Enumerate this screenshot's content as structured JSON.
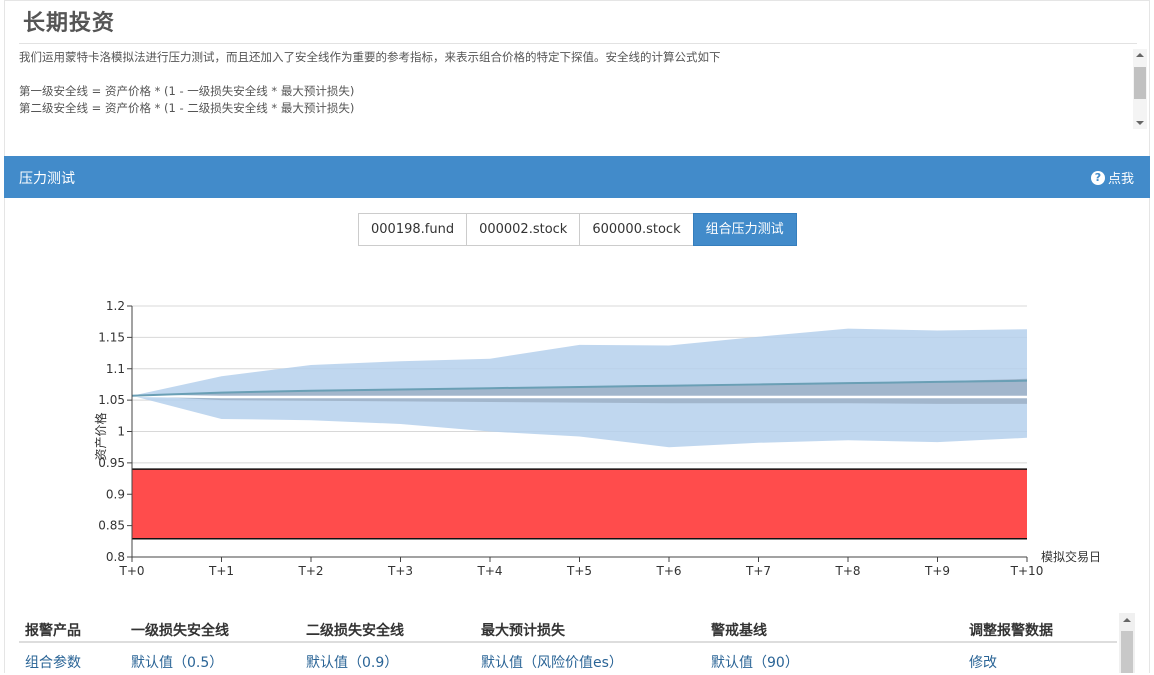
{
  "header": {
    "title": "长期投资",
    "description": [
      "我们运用蒙特卡洛模拟法进行压力测试，而且还加入了安全线作为重要的参考指标，来表示组合价格的特定下探值。安全线的计算公式如下",
      "",
      "第一级安全线 = 资产价格 * (1 - 一级损失安全线 * 最大预计损失)",
      "第二级安全线 = 资产价格 * (1 - 二级损失安全线 * 最大预计损失)"
    ]
  },
  "panel": {
    "title": "压力测试",
    "help_label": "点我",
    "help_icon": "question-circle-icon",
    "accent_color": "#428bca"
  },
  "buttons": [
    {
      "label": "000198.fund",
      "active": false
    },
    {
      "label": "000002.stock",
      "active": false
    },
    {
      "label": "600000.stock",
      "active": false
    },
    {
      "label": "组合压力测试",
      "active": true
    }
  ],
  "chart_data": {
    "type": "area",
    "xlabel": "模拟交易日",
    "ylabel": "资产价格",
    "ylim": [
      0.8,
      1.2
    ],
    "yticks": [
      0.8,
      0.85,
      0.9,
      0.95,
      1,
      1.05,
      1.1,
      1.15,
      1.2
    ],
    "ytick_labels": [
      "0.8",
      "0.85",
      "0.9",
      "0.95",
      "1",
      "1.05",
      "1.1",
      "1.15",
      "1.2"
    ],
    "categories": [
      "T+0",
      "T+1",
      "T+2",
      "T+3",
      "T+4",
      "T+5",
      "T+6",
      "T+7",
      "T+8",
      "T+9",
      "T+10"
    ],
    "grid": true,
    "outer_band": {
      "color": "#b5d0ec",
      "upper": [
        1.057,
        1.088,
        1.106,
        1.112,
        1.116,
        1.138,
        1.137,
        1.151,
        1.164,
        1.161,
        1.163
      ],
      "lower": [
        1.057,
        1.02,
        1.018,
        1.012,
        1.0,
        0.992,
        0.975,
        0.982,
        0.986,
        0.983,
        0.99
      ]
    },
    "inner_band": {
      "color": "#9fb3c8",
      "upper": [
        1.057,
        1.063,
        1.066,
        1.068,
        1.07,
        1.072,
        1.074,
        1.076,
        1.078,
        1.08,
        1.084
      ],
      "lower": [
        1.057,
        1.05,
        1.049,
        1.048,
        1.047,
        1.046,
        1.045,
        1.045,
        1.045,
        1.044,
        1.044
      ]
    },
    "median_line": {
      "color": "#6a9fb5",
      "values": [
        1.057,
        1.062,
        1.065,
        1.067,
        1.069,
        1.071,
        1.073,
        1.075,
        1.077,
        1.079,
        1.081
      ]
    },
    "white_line": {
      "color": "#ffffff",
      "values": [
        1.057,
        1.055,
        1.055,
        1.055,
        1.055,
        1.055,
        1.055,
        1.055,
        1.055,
        1.055,
        1.055
      ]
    },
    "safety_zone": {
      "color": "#ff4c4c",
      "upper": 0.94,
      "lower": 0.829
    }
  },
  "table": {
    "headers": [
      "报警产品",
      "一级损失安全线",
      "二级损失安全线",
      "最大预计损失",
      "警戒基线",
      "调整报警数据"
    ],
    "rows": [
      [
        "组合参数",
        "默认值（0.5）",
        "默认值（0.9）",
        "默认值（风险价值es）",
        "默认值（90）",
        "修改"
      ]
    ]
  }
}
